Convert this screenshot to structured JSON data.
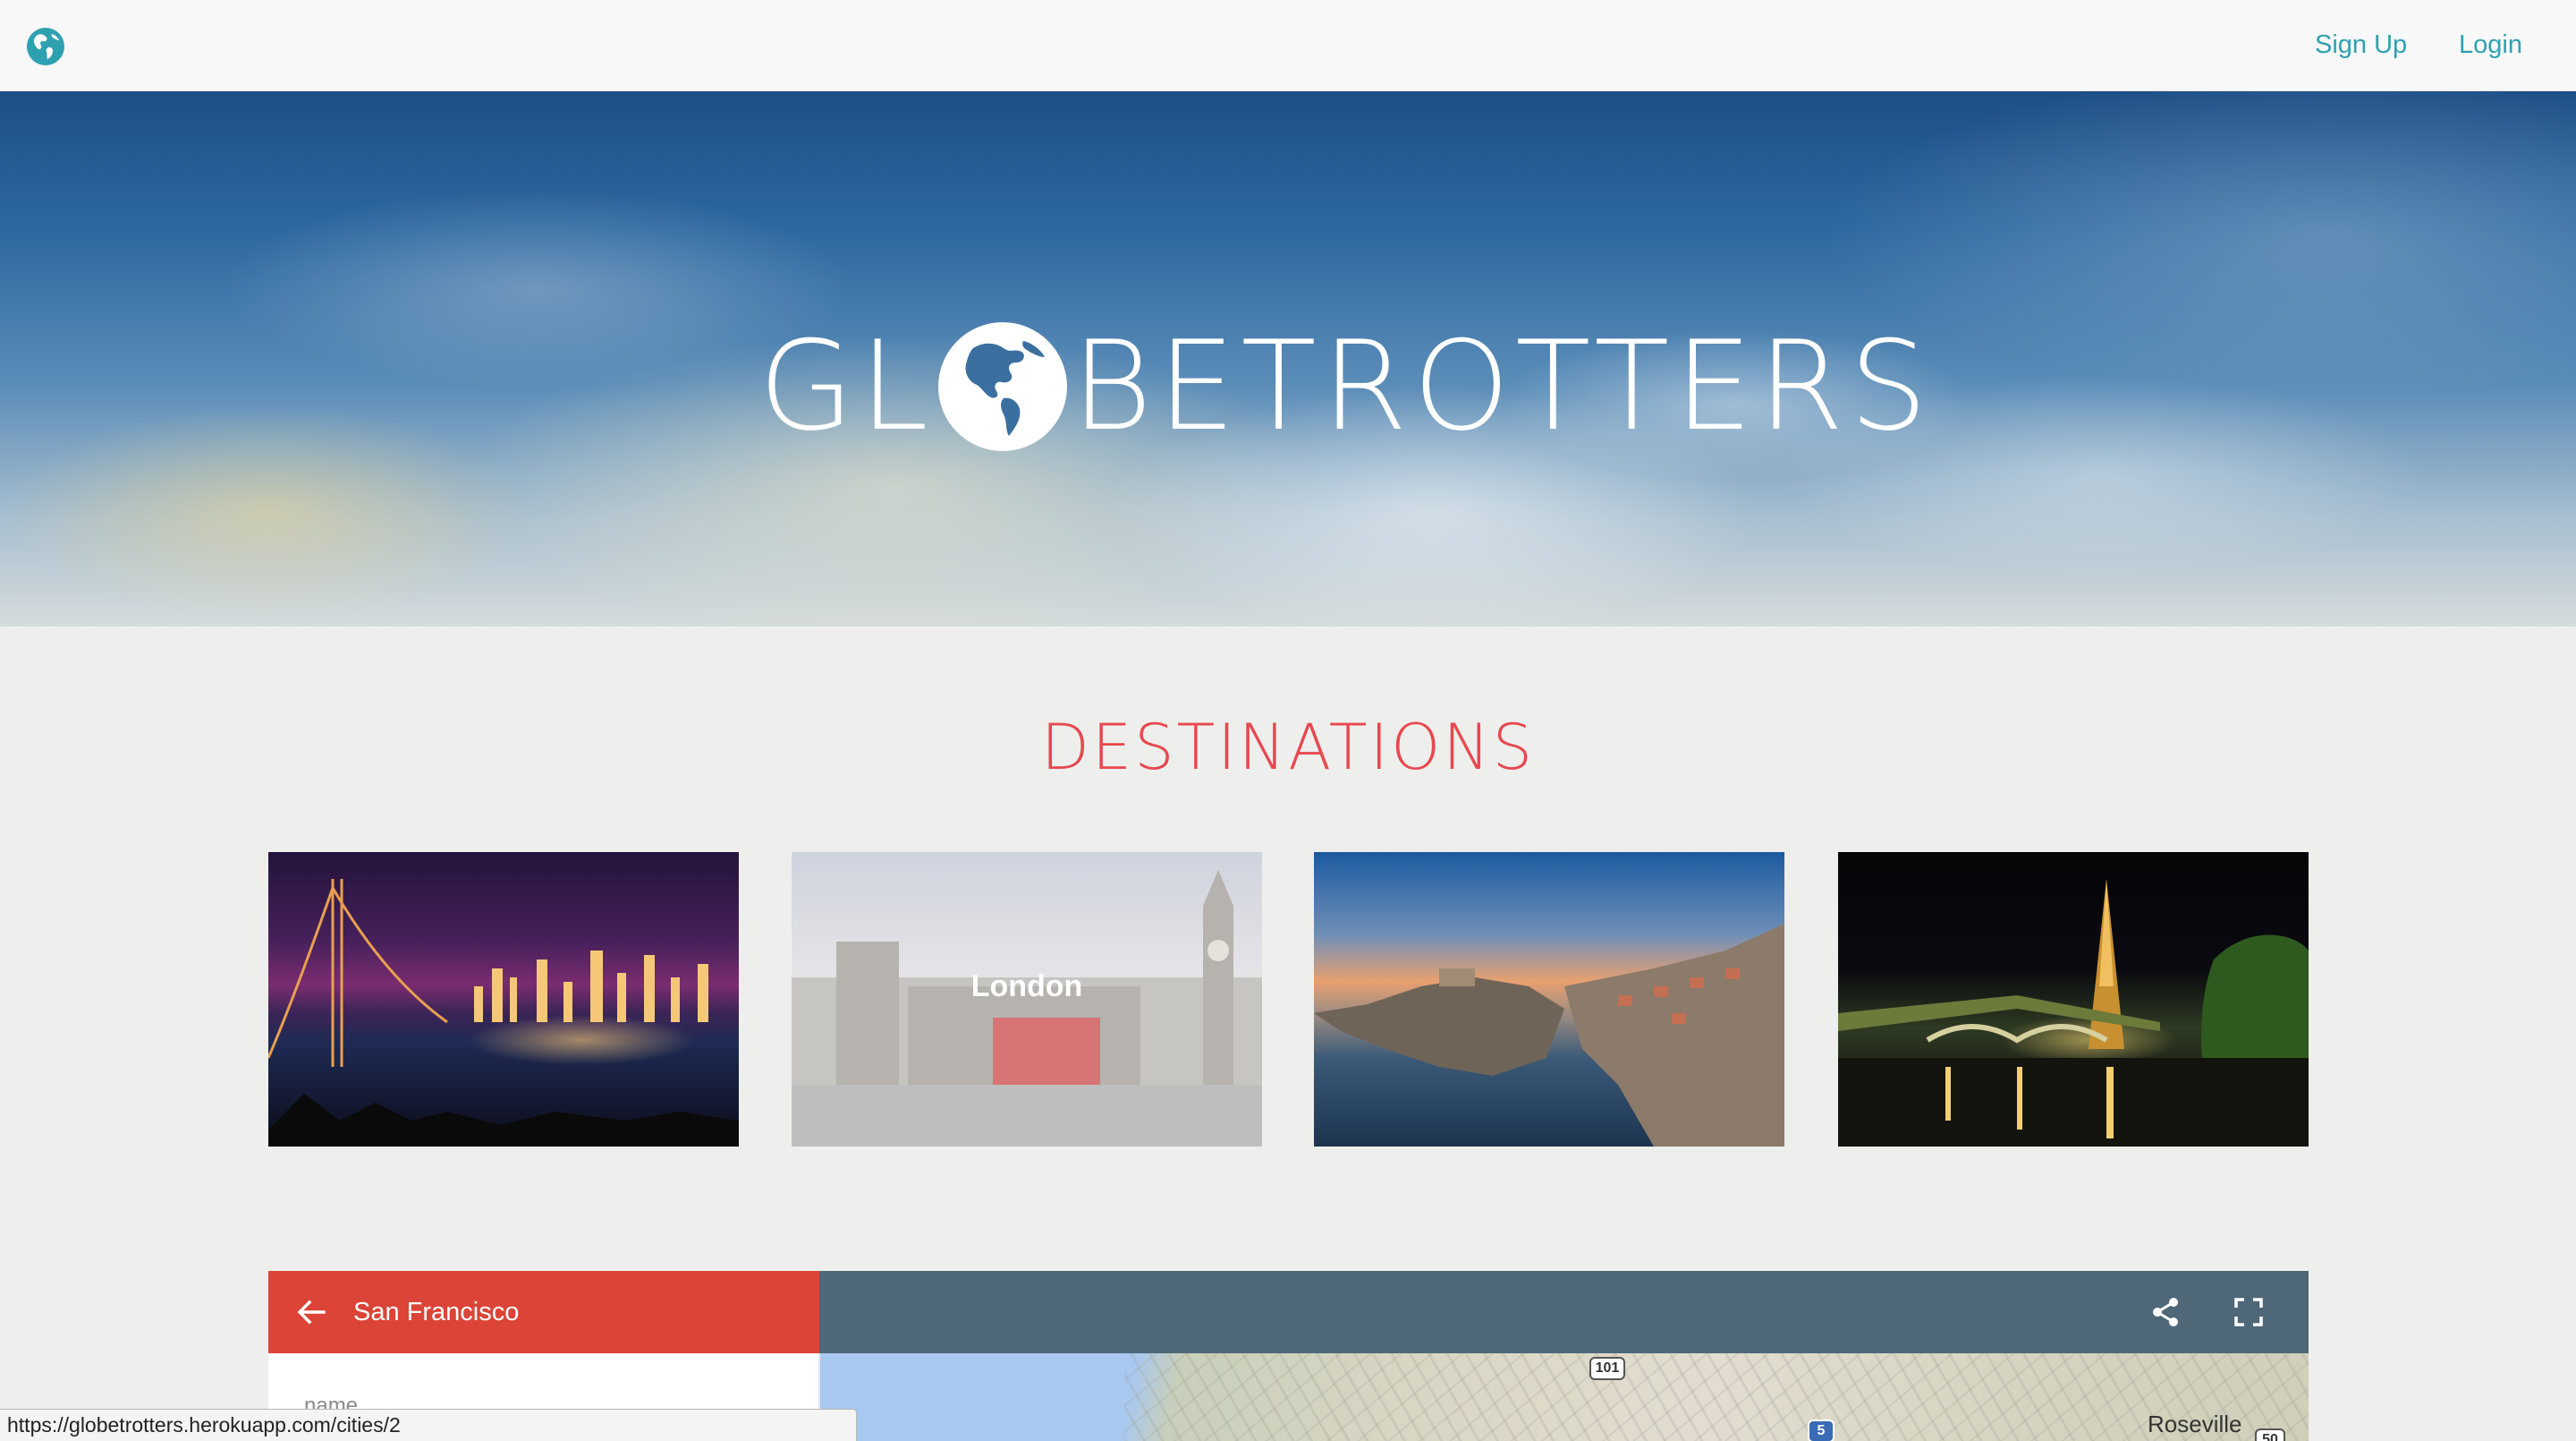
{
  "navbar": {
    "logo_icon": "globe-icon",
    "links": [
      {
        "label": "Sign Up"
      },
      {
        "label": "Login"
      }
    ],
    "link_color": "#2ea1b0"
  },
  "hero": {
    "title_left": "GL",
    "title_globe_icon": "globe-americas-icon",
    "title_right": "BETROTTERS"
  },
  "destinations": {
    "heading": "DESTINATIONS",
    "heading_color": "#e8474f",
    "cards": [
      {
        "label": "",
        "image": "san-francisco-bay-bridge-night"
      },
      {
        "label": "London",
        "image": "london-big-ben-red-bus",
        "hovered": true
      },
      {
        "label": "",
        "image": "dubrovnik-coast-sunset"
      },
      {
        "label": "",
        "image": "paris-eiffel-tower-night"
      }
    ]
  },
  "map_widget": {
    "title": "San Francisco",
    "header_color": "#db4437",
    "topbar_color": "#4e6878",
    "back_icon": "arrow-left-icon",
    "share_icon": "share-icon",
    "fullscreen_icon": "fullscreen-icon",
    "sidebar_field_label": "name",
    "map": {
      "highway_shields": [
        "101",
        "5",
        "50"
      ],
      "place_labels": [
        "Roseville"
      ]
    }
  },
  "status_bar": {
    "url": "https://globetrotters.herokuapp.com/cities/2"
  }
}
